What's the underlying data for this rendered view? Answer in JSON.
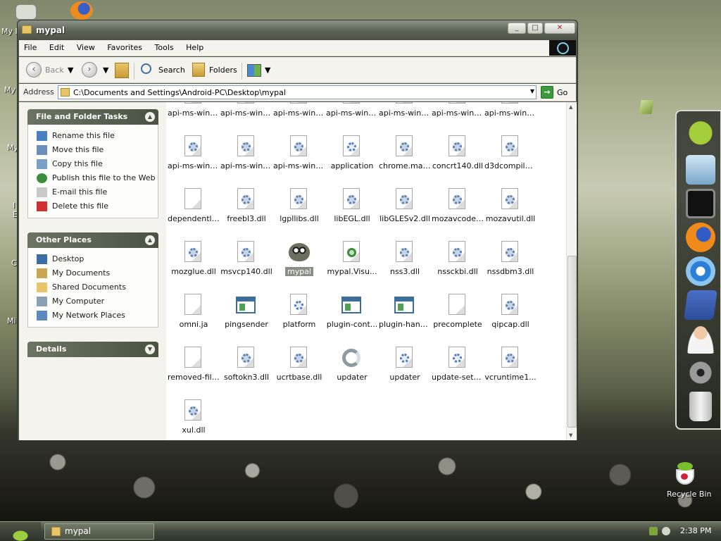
{
  "window": {
    "title": "mypal",
    "controls": {
      "minimize": "_",
      "maximize": "□",
      "close": "✕"
    }
  },
  "menu": [
    "File",
    "Edit",
    "View",
    "Favorites",
    "Tools",
    "Help"
  ],
  "toolbar": {
    "back": "Back",
    "search": "Search",
    "folders": "Folders"
  },
  "address": {
    "label": "Address",
    "path": "C:\\Documents and Settings\\Android-PC\\Desktop\\mypal",
    "go": "Go"
  },
  "tasks_panel": {
    "title": "File and Folder Tasks",
    "items": [
      {
        "label": "Rename this file",
        "icon": "rename-icon"
      },
      {
        "label": "Move this file",
        "icon": "move-icon"
      },
      {
        "label": "Copy this file",
        "icon": "copy-icon"
      },
      {
        "label": "Publish this file to the Web",
        "icon": "globe-icon"
      },
      {
        "label": "E-mail this file",
        "icon": "email-icon"
      },
      {
        "label": "Delete this file",
        "icon": "delete-icon"
      }
    ]
  },
  "places_panel": {
    "title": "Other Places",
    "items": [
      {
        "label": "Desktop",
        "icon": "desktop-icon"
      },
      {
        "label": "My Documents",
        "icon": "documents-icon"
      },
      {
        "label": "Shared Documents",
        "icon": "folder-icon"
      },
      {
        "label": "My Computer",
        "icon": "computer-icon"
      },
      {
        "label": "My Network Places",
        "icon": "network-icon"
      }
    ]
  },
  "details_panel": {
    "title": "Details"
  },
  "files": [
    {
      "name": "api-ms-win-...",
      "type": "dll"
    },
    {
      "name": "api-ms-win-...",
      "type": "dll"
    },
    {
      "name": "api-ms-win-...",
      "type": "dll"
    },
    {
      "name": "api-ms-win-...",
      "type": "dll"
    },
    {
      "name": "api-ms-win-...",
      "type": "dll"
    },
    {
      "name": "api-ms-win-...",
      "type": "dll"
    },
    {
      "name": "api-ms-win-...",
      "type": "dll"
    },
    {
      "name": "api-ms-win-...",
      "type": "dll"
    },
    {
      "name": "api-ms-win-...",
      "type": "dll"
    },
    {
      "name": "api-ms-win-...",
      "type": "dll"
    },
    {
      "name": "application",
      "type": "config"
    },
    {
      "name": "chrome.man...",
      "type": "dll"
    },
    {
      "name": "concrt140.dll",
      "type": "dll"
    },
    {
      "name": "d3dcompiler...",
      "type": "dll"
    },
    {
      "name": "dependentli...",
      "type": "blank"
    },
    {
      "name": "freebl3.dll",
      "type": "dll"
    },
    {
      "name": "lgpllibs.dll",
      "type": "dll"
    },
    {
      "name": "libEGL.dll",
      "type": "dll"
    },
    {
      "name": "libGLESv2.dll",
      "type": "dll"
    },
    {
      "name": "mozavcodec...",
      "type": "dll"
    },
    {
      "name": "mozavutil.dll",
      "type": "dll"
    },
    {
      "name": "mozglue.dll",
      "type": "dll"
    },
    {
      "name": "msvcp140.dll",
      "type": "dll"
    },
    {
      "name": "mypal",
      "type": "app"
    },
    {
      "name": "mypal.Visu...",
      "type": "manifest"
    },
    {
      "name": "nss3.dll",
      "type": "dll"
    },
    {
      "name": "nssckbi.dll",
      "type": "dll"
    },
    {
      "name": "nssdbm3.dll",
      "type": "dll"
    },
    {
      "name": "omni.ja",
      "type": "blank"
    },
    {
      "name": "pingsender",
      "type": "exe"
    },
    {
      "name": "platform",
      "type": "config"
    },
    {
      "name": "plugin-cont...",
      "type": "exe"
    },
    {
      "name": "plugin-hang-ui",
      "type": "exe"
    },
    {
      "name": "precomplete",
      "type": "blank"
    },
    {
      "name": "qipcap.dll",
      "type": "dll"
    },
    {
      "name": "removed-files",
      "type": "blank"
    },
    {
      "name": "softokn3.dll",
      "type": "dll"
    },
    {
      "name": "ucrtbase.dll",
      "type": "dll"
    },
    {
      "name": "updater",
      "type": "updater"
    },
    {
      "name": "updater",
      "type": "config"
    },
    {
      "name": "update-setti...",
      "type": "config"
    },
    {
      "name": "vcruntime1...",
      "type": "dll"
    },
    {
      "name": "xul.dll",
      "type": "dll"
    }
  ],
  "selected_file": "mypal",
  "desktop": {
    "recycle_bin": "Recycle Bin",
    "edge_labels": [
      "My I",
      "My",
      "My",
      "I",
      "E",
      "C",
      "Mi"
    ]
  },
  "taskbar": {
    "window_button": "mypal",
    "clock": "2:38 PM"
  }
}
